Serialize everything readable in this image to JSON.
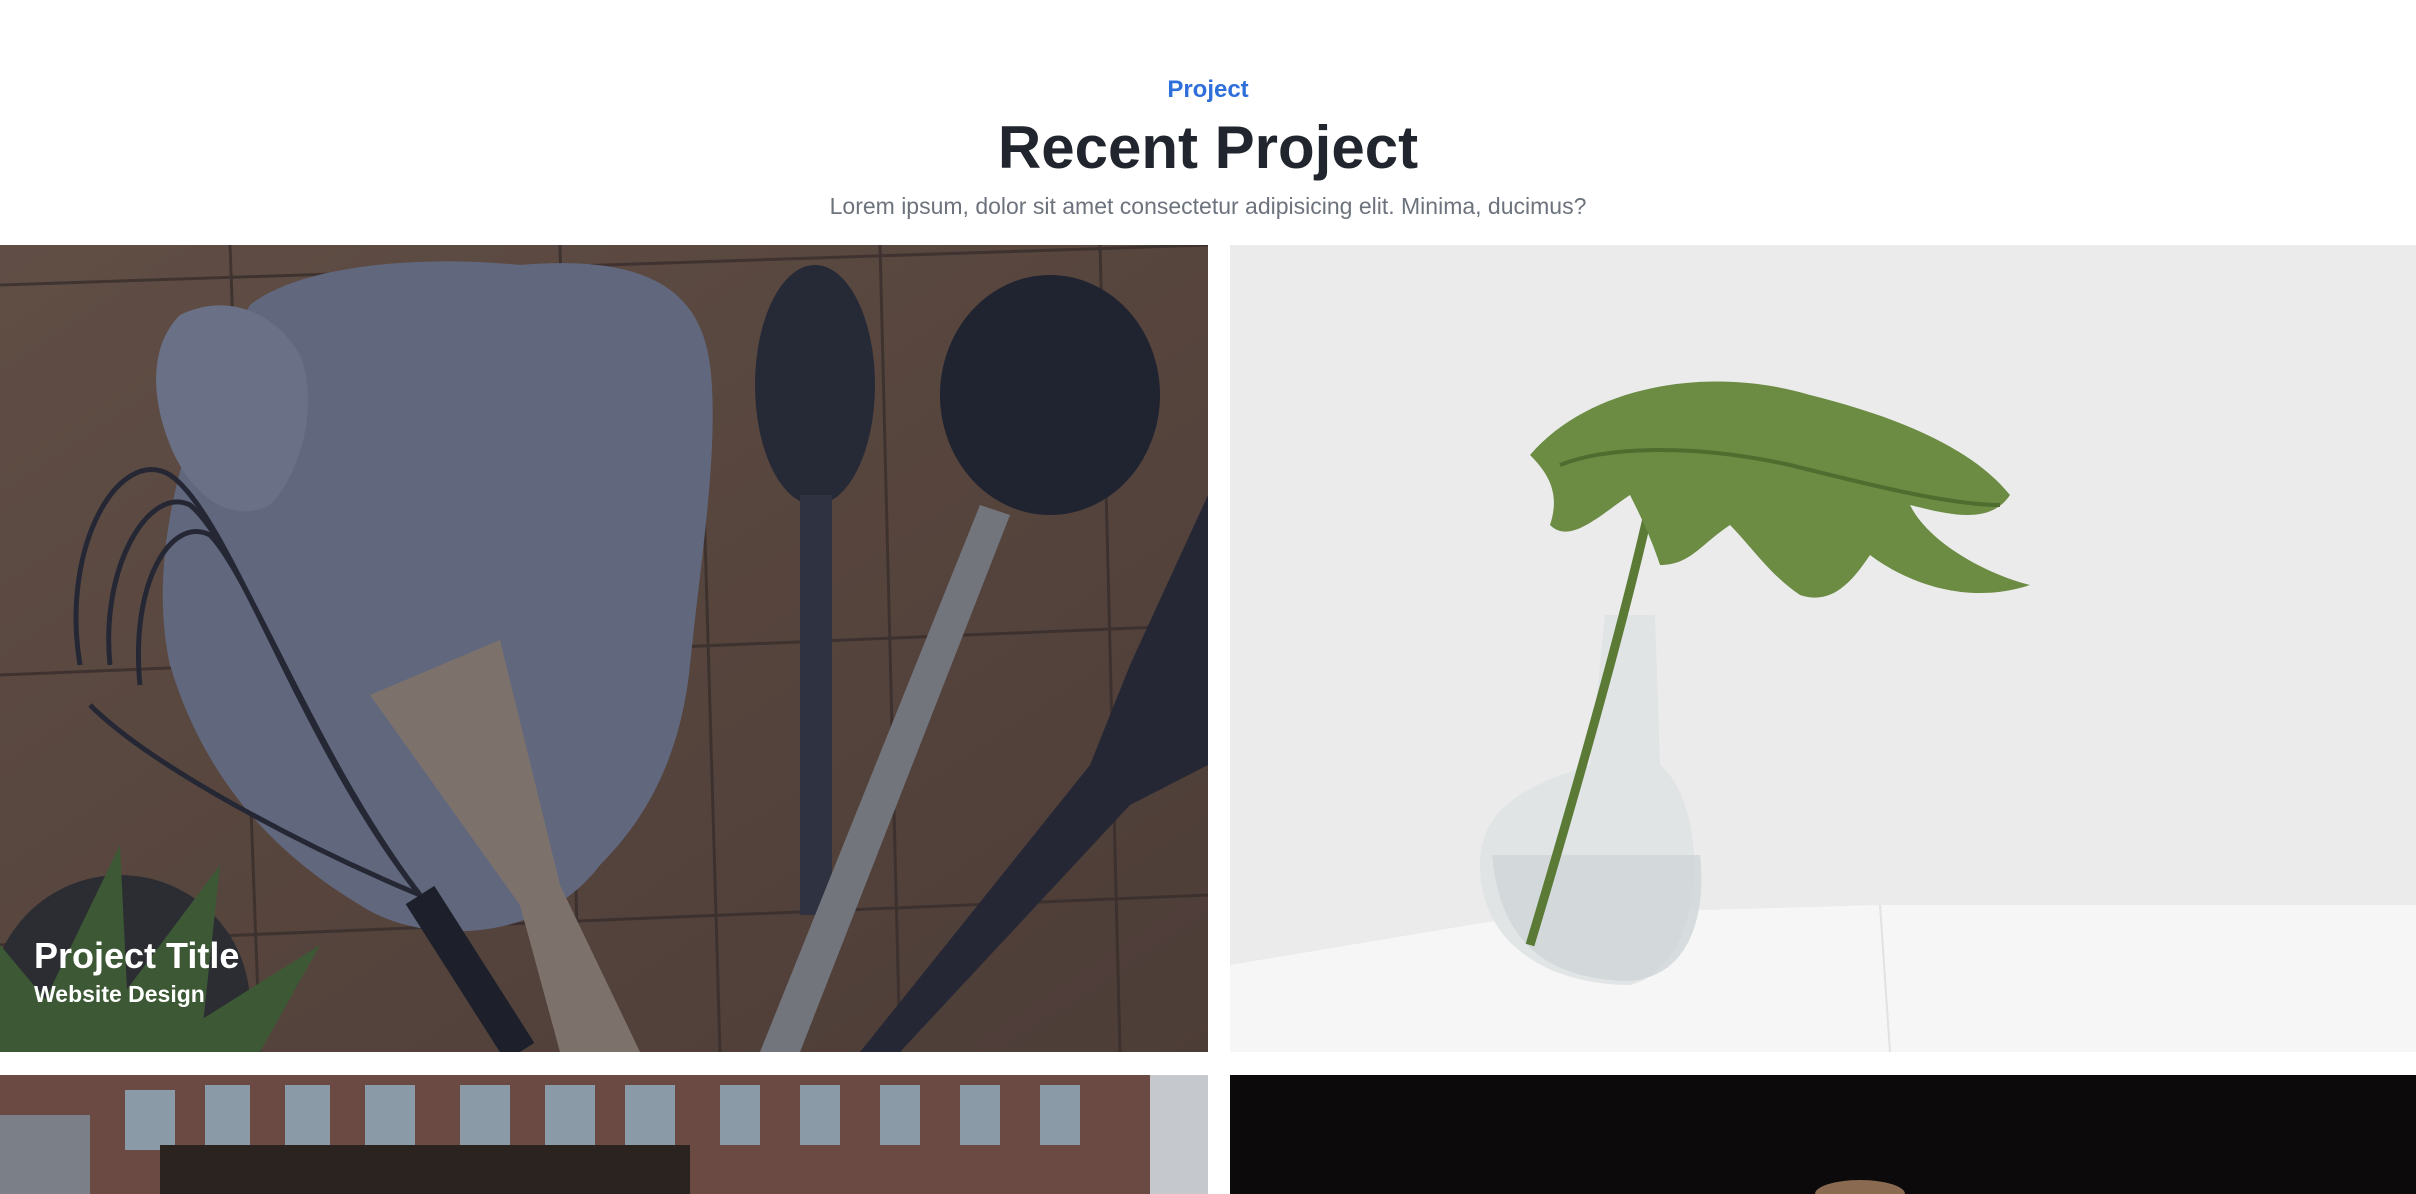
{
  "header": {
    "eyebrow": "Project",
    "title": "Recent Project",
    "subtitle": "Lorem ipsum, dolor sit amet consectetur adipisicing elit. Minima, ducimus?"
  },
  "projects": [
    {
      "title": "Project Title",
      "category": "Website Design",
      "image": "kitchen-utensils-photo"
    },
    {
      "image": "plant-in-vase-photo"
    },
    {
      "image": "brick-building-photo"
    },
    {
      "image": "dark-stage-photo"
    }
  ],
  "colors": {
    "accent": "#2f6fd9",
    "heading": "#21252d",
    "muted": "#6c737c"
  }
}
